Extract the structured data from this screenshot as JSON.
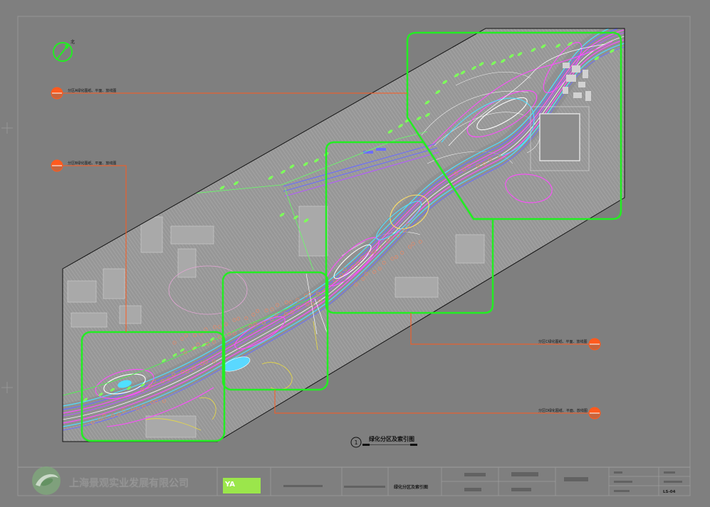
{
  "drawing": {
    "view_number": "1",
    "title": "绿化分区及索引图",
    "north_label": "北",
    "index_labels": [
      {
        "zone": "A",
        "text": "分区A绿化图纸、平面、放线图"
      },
      {
        "zone": "B",
        "text": "分区B绿化图纸、平面、放线图"
      },
      {
        "zone": "C",
        "text": "分区C绿化图纸、平面、放线图"
      },
      {
        "zone": "D",
        "text": "分区D绿化图纸、平面、放线图"
      }
    ]
  },
  "title_block": {
    "company": "上海景观实业发展有限公司",
    "logo_text": "YA",
    "drawing_name": "绿化分区及索引图",
    "sheet_number": "LS-04"
  },
  "colors": {
    "background": "#7f7f7f",
    "zone_outline": "#22ee22",
    "leader_line": "#ff5a1e",
    "boundary": "#111111",
    "road_cyan": "#4fe0ff",
    "road_magenta": "#ff4dff",
    "road_blue": "#6d6dff",
    "road_purple": "#b45cff",
    "planting_green": "#7dff5a",
    "planting_salmon": "#e08a6a",
    "logo_green": "#9be64b"
  }
}
